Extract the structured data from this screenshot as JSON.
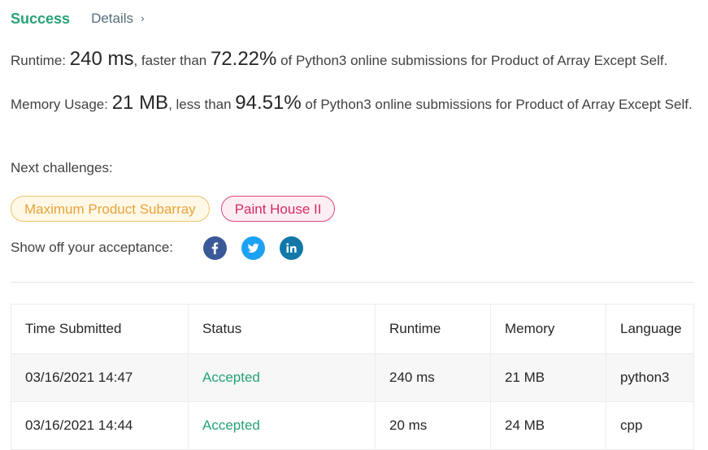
{
  "header": {
    "success_label": "Success",
    "details_label": "Details",
    "details_chevron": "›"
  },
  "runtime": {
    "prefix": "Runtime: ",
    "value": "240 ms",
    "middle": ", faster than ",
    "percent": "72.22%",
    "suffix": " of Python3 online submissions for Product of Array Except Self."
  },
  "memory": {
    "prefix": "Memory Usage: ",
    "value": "21 MB",
    "middle": ", less than ",
    "percent": "94.51%",
    "suffix": " of Python3 online submissions for Product of Array Except Self."
  },
  "next_challenges": {
    "label": "Next challenges:",
    "items": [
      {
        "label": "Maximum Product Subarray",
        "difficulty": "medium"
      },
      {
        "label": "Paint House II",
        "difficulty": "hard"
      }
    ]
  },
  "share": {
    "label": "Show off your acceptance:",
    "icons": [
      "facebook-icon",
      "twitter-icon",
      "linkedin-icon"
    ]
  },
  "submissions": {
    "headers": [
      "Time Submitted",
      "Status",
      "Runtime",
      "Memory",
      "Language"
    ],
    "rows": [
      {
        "time": "03/16/2021 14:47",
        "status": "Accepted",
        "runtime": "240 ms",
        "memory": "21 MB",
        "language": "python3"
      },
      {
        "time": "03/16/2021 14:44",
        "status": "Accepted",
        "runtime": "20 ms",
        "memory": "24 MB",
        "language": "cpp"
      }
    ]
  },
  "colors": {
    "accent": "#26a17a",
    "medium": "#e8a33a",
    "hard": "#d42a63",
    "facebook": "#3b5998",
    "twitter": "#1da1f2",
    "linkedin": "#1278a8"
  }
}
